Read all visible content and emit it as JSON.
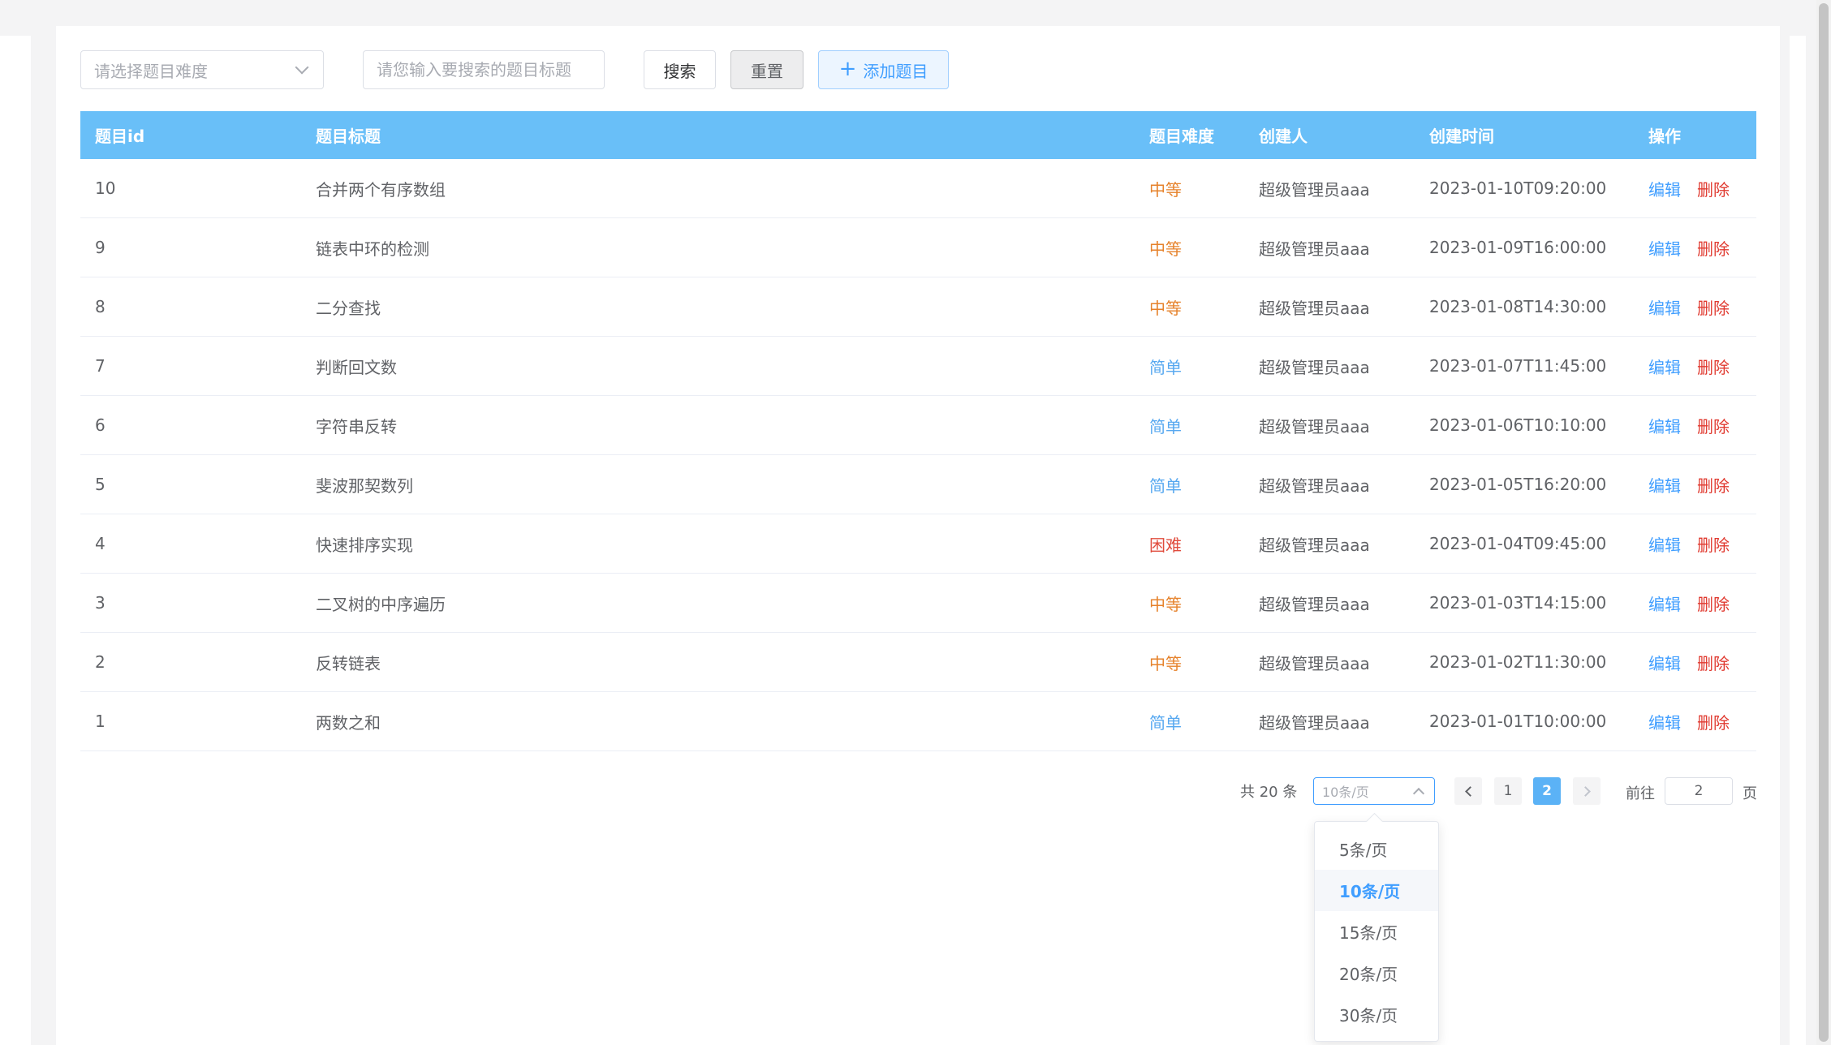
{
  "filters": {
    "difficulty_placeholder": "请选择题目难度",
    "title_placeholder": "请您输入要搜索的题目标题"
  },
  "toolbar": {
    "search_label": "搜索",
    "reset_label": "重置",
    "add_label": "添加题目"
  },
  "table": {
    "headers": [
      "题目id",
      "题目标题",
      "题目难度",
      "创建人",
      "创建时间",
      "操作"
    ],
    "rows": [
      {
        "id": "10",
        "title": "合并两个有序数组",
        "difficulty": "中等",
        "creator": "超级管理员aaa",
        "created": "2023-01-10T09:20:00"
      },
      {
        "id": "9",
        "title": "链表中环的检测",
        "difficulty": "中等",
        "creator": "超级管理员aaa",
        "created": "2023-01-09T16:00:00"
      },
      {
        "id": "8",
        "title": "二分查找",
        "difficulty": "中等",
        "creator": "超级管理员aaa",
        "created": "2023-01-08T14:30:00"
      },
      {
        "id": "7",
        "title": "判断回文数",
        "difficulty": "简单",
        "creator": "超级管理员aaa",
        "created": "2023-01-07T11:45:00"
      },
      {
        "id": "6",
        "title": "字符串反转",
        "difficulty": "简单",
        "creator": "超级管理员aaa",
        "created": "2023-01-06T10:10:00"
      },
      {
        "id": "5",
        "title": "斐波那契数列",
        "difficulty": "简单",
        "creator": "超级管理员aaa",
        "created": "2023-01-05T16:20:00"
      },
      {
        "id": "4",
        "title": "快速排序实现",
        "difficulty": "困难",
        "creator": "超级管理员aaa",
        "created": "2023-01-04T09:45:00"
      },
      {
        "id": "3",
        "title": "二叉树的中序遍历",
        "difficulty": "中等",
        "creator": "超级管理员aaa",
        "created": "2023-01-03T14:15:00"
      },
      {
        "id": "2",
        "title": "反转链表",
        "difficulty": "中等",
        "creator": "超级管理员aaa",
        "created": "2023-01-02T11:30:00"
      },
      {
        "id": "1",
        "title": "两数之和",
        "difficulty": "简单",
        "creator": "超级管理员aaa",
        "created": "2023-01-01T10:00:00"
      }
    ],
    "actions": {
      "edit": "编辑",
      "delete": "删除"
    }
  },
  "difficulty_colors": {
    "中等": "#e6822b",
    "简单": "#57a8f0",
    "困难": "#e04b3c"
  },
  "pagination": {
    "total": "共 20 条",
    "page_size": "10条/页",
    "pages": [
      "1",
      "2"
    ],
    "current_page": "2",
    "goto_label": "前往",
    "goto_value": "2",
    "goto_suffix": "页",
    "size_options": [
      "5条/页",
      "10条/页",
      "15条/页",
      "20条/页",
      "30条/页"
    ],
    "selected_size": "10条/页"
  },
  "colors": {
    "header_bg": "#69bff8",
    "primary": "#409eff",
    "danger": "#e0392f"
  }
}
